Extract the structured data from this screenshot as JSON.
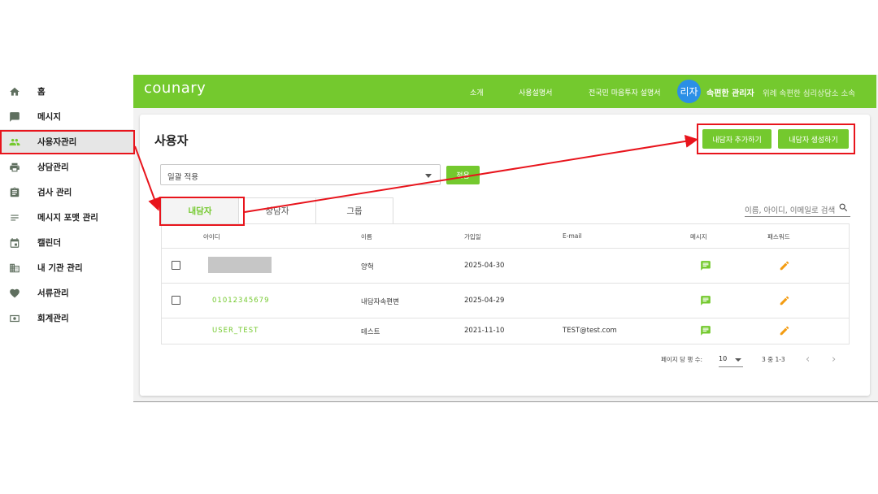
{
  "sidebar": {
    "items": [
      {
        "label": "홈",
        "icon": "home-icon"
      },
      {
        "label": "메시지",
        "icon": "chat-icon"
      },
      {
        "label": "사용자관리",
        "icon": "people-icon"
      },
      {
        "label": "상담관리",
        "icon": "print-icon"
      },
      {
        "label": "검사 관리",
        "icon": "clipboard-icon"
      },
      {
        "label": "메시지 포맷 관리",
        "icon": "list-icon"
      },
      {
        "label": "캘린더",
        "icon": "calendar-icon"
      },
      {
        "label": "내 기관 관리",
        "icon": "building-icon"
      },
      {
        "label": "서류관리",
        "icon": "heart-icon"
      },
      {
        "label": "회계관리",
        "icon": "money-icon"
      }
    ],
    "active_index": 2
  },
  "topbar": {
    "logo": "counary",
    "nav": [
      "소개",
      "사용설명서",
      "전국민 마음투자 설명서"
    ],
    "avatar_text": "리자",
    "admin_name": "속편한 관리자",
    "org_name": "위례 속편한 심리상담소 소속",
    "color": "#74c92e"
  },
  "main": {
    "title": "사용자",
    "add_client_button": "내담자 추가하기",
    "create_client_button": "내담자 생성하기",
    "bulk_select": "일괄 적용",
    "apply_button": "적용",
    "tabs": [
      "내담자",
      "상담자",
      "그룹"
    ],
    "search_placeholder": "이름, 아이디, 이메일로 검색",
    "table": {
      "headers": [
        "아이디",
        "이름",
        "가입일",
        "E-mail",
        "메시지",
        "패스워드"
      ],
      "rows": [
        {
          "id": "",
          "name": "양혁",
          "joined": "2025-04-30",
          "email": ""
        },
        {
          "id": "01012345679",
          "name": "내담자속편변",
          "joined": "2025-04-29",
          "email": ""
        },
        {
          "id": "USER_TEST",
          "name": "테스트",
          "joined": "2021-11-10",
          "email": "TEST@test.com"
        }
      ]
    },
    "pagination": {
      "rows_per_page_label": "페이지 당 행 수:",
      "rows_per_page": "10",
      "range": "3 중 1-3"
    }
  },
  "colors": {
    "accent": "#74c92e",
    "annotation": "#e8141c",
    "avatar": "#2b8fe6",
    "edit": "#f39c12"
  }
}
